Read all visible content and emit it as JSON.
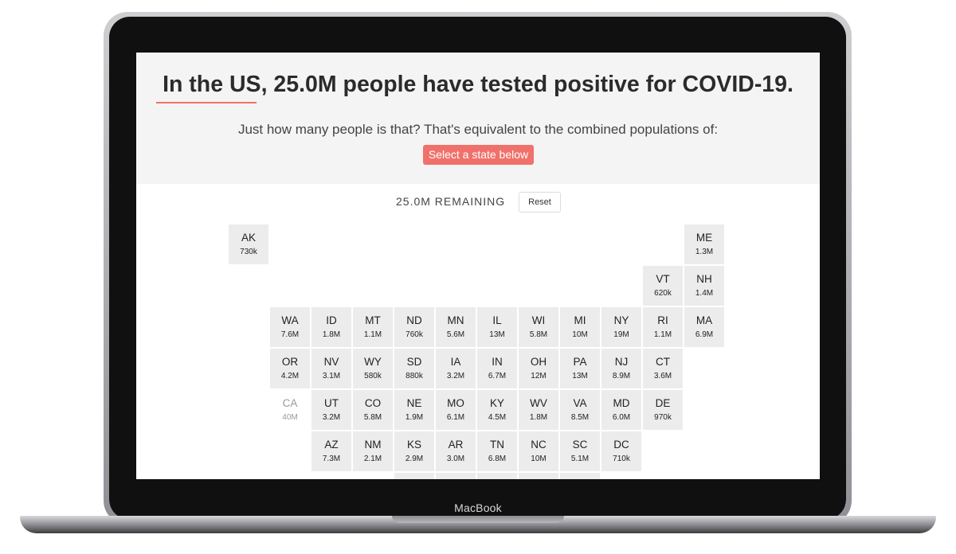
{
  "device": {
    "brand": "MacBook"
  },
  "page": {
    "headline": "In the US, 25.0M people have tested positive for COVID-19.",
    "subline": "Just how many people is that? That's equivalent to the combined populations of:",
    "cta_label": "Select a state below",
    "remaining_label": "25.0M REMAINING",
    "reset_label": "Reset"
  },
  "colors": {
    "accent": "#f0716b",
    "hero_bg": "#f4f4f4",
    "tile_bg": "#ececec"
  },
  "states": [
    {
      "abbr": "AK",
      "pop": "730k",
      "row": 0,
      "col": 0
    },
    {
      "abbr": "ME",
      "pop": "1.3M",
      "row": 0,
      "col": 11
    },
    {
      "abbr": "VT",
      "pop": "620k",
      "row": 1,
      "col": 10
    },
    {
      "abbr": "NH",
      "pop": "1.4M",
      "row": 1,
      "col": 11
    },
    {
      "abbr": "WA",
      "pop": "7.6M",
      "row": 2,
      "col": 1
    },
    {
      "abbr": "ID",
      "pop": "1.8M",
      "row": 2,
      "col": 2
    },
    {
      "abbr": "MT",
      "pop": "1.1M",
      "row": 2,
      "col": 3
    },
    {
      "abbr": "ND",
      "pop": "760k",
      "row": 2,
      "col": 4
    },
    {
      "abbr": "MN",
      "pop": "5.6M",
      "row": 2,
      "col": 5
    },
    {
      "abbr": "IL",
      "pop": "13M",
      "row": 2,
      "col": 6
    },
    {
      "abbr": "WI",
      "pop": "5.8M",
      "row": 2,
      "col": 7
    },
    {
      "abbr": "MI",
      "pop": "10M",
      "row": 2,
      "col": 8
    },
    {
      "abbr": "NY",
      "pop": "19M",
      "row": 2,
      "col": 9
    },
    {
      "abbr": "RI",
      "pop": "1.1M",
      "row": 2,
      "col": 10
    },
    {
      "abbr": "MA",
      "pop": "6.9M",
      "row": 2,
      "col": 11
    },
    {
      "abbr": "OR",
      "pop": "4.2M",
      "row": 3,
      "col": 1
    },
    {
      "abbr": "NV",
      "pop": "3.1M",
      "row": 3,
      "col": 2
    },
    {
      "abbr": "WY",
      "pop": "580k",
      "row": 3,
      "col": 3
    },
    {
      "abbr": "SD",
      "pop": "880k",
      "row": 3,
      "col": 4
    },
    {
      "abbr": "IA",
      "pop": "3.2M",
      "row": 3,
      "col": 5
    },
    {
      "abbr": "IN",
      "pop": "6.7M",
      "row": 3,
      "col": 6
    },
    {
      "abbr": "OH",
      "pop": "12M",
      "row": 3,
      "col": 7
    },
    {
      "abbr": "PA",
      "pop": "13M",
      "row": 3,
      "col": 8
    },
    {
      "abbr": "NJ",
      "pop": "8.9M",
      "row": 3,
      "col": 9
    },
    {
      "abbr": "CT",
      "pop": "3.6M",
      "row": 3,
      "col": 10
    },
    {
      "abbr": "CA",
      "pop": "40M",
      "row": 4,
      "col": 1,
      "disabled": true
    },
    {
      "abbr": "UT",
      "pop": "3.2M",
      "row": 4,
      "col": 2
    },
    {
      "abbr": "CO",
      "pop": "5.8M",
      "row": 4,
      "col": 3
    },
    {
      "abbr": "NE",
      "pop": "1.9M",
      "row": 4,
      "col": 4
    },
    {
      "abbr": "MO",
      "pop": "6.1M",
      "row": 4,
      "col": 5
    },
    {
      "abbr": "KY",
      "pop": "4.5M",
      "row": 4,
      "col": 6
    },
    {
      "abbr": "WV",
      "pop": "1.8M",
      "row": 4,
      "col": 7
    },
    {
      "abbr": "VA",
      "pop": "8.5M",
      "row": 4,
      "col": 8
    },
    {
      "abbr": "MD",
      "pop": "6.0M",
      "row": 4,
      "col": 9
    },
    {
      "abbr": "DE",
      "pop": "970k",
      "row": 4,
      "col": 10
    },
    {
      "abbr": "AZ",
      "pop": "7.3M",
      "row": 5,
      "col": 2
    },
    {
      "abbr": "NM",
      "pop": "2.1M",
      "row": 5,
      "col": 3
    },
    {
      "abbr": "KS",
      "pop": "2.9M",
      "row": 5,
      "col": 4
    },
    {
      "abbr": "AR",
      "pop": "3.0M",
      "row": 5,
      "col": 5
    },
    {
      "abbr": "TN",
      "pop": "6.8M",
      "row": 5,
      "col": 6
    },
    {
      "abbr": "NC",
      "pop": "10M",
      "row": 5,
      "col": 7
    },
    {
      "abbr": "SC",
      "pop": "5.1M",
      "row": 5,
      "col": 8
    },
    {
      "abbr": "DC",
      "pop": "710k",
      "row": 5,
      "col": 9
    },
    {
      "abbr": "",
      "pop": "",
      "row": 6,
      "col": 4
    },
    {
      "abbr": "",
      "pop": "",
      "row": 6,
      "col": 5
    },
    {
      "abbr": "",
      "pop": "",
      "row": 6,
      "col": 6
    },
    {
      "abbr": "",
      "pop": "",
      "row": 6,
      "col": 7
    },
    {
      "abbr": "",
      "pop": "",
      "row": 6,
      "col": 8
    }
  ]
}
